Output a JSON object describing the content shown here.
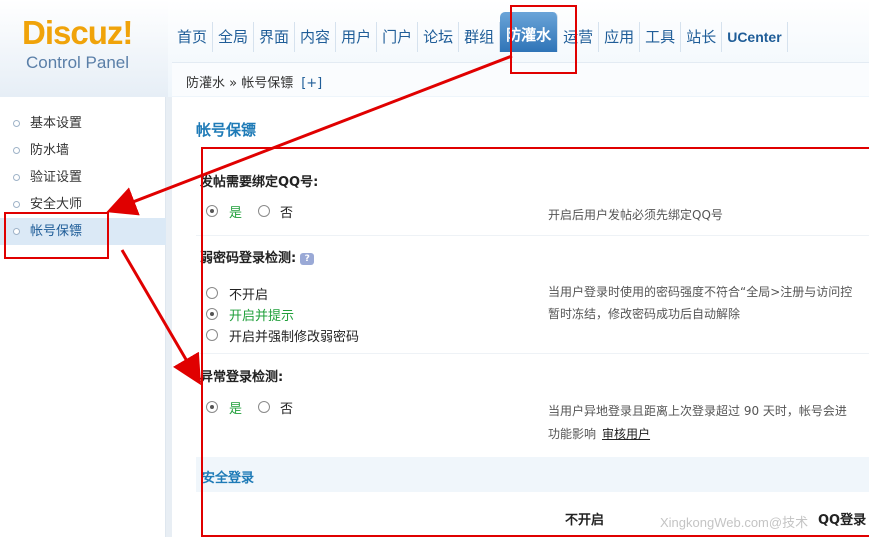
{
  "logo": {
    "main": "Discuz!",
    "sub": "Control Panel"
  },
  "topnav": [
    {
      "label": "首页"
    },
    {
      "label": "全局"
    },
    {
      "label": "界面"
    },
    {
      "label": "内容"
    },
    {
      "label": "用户"
    },
    {
      "label": "门户"
    },
    {
      "label": "论坛"
    },
    {
      "label": "群组"
    },
    {
      "label": "防灌水",
      "active": true
    },
    {
      "label": "运营"
    },
    {
      "label": "应用"
    },
    {
      "label": "工具"
    },
    {
      "label": "站长"
    },
    {
      "label": "UCenter"
    }
  ],
  "breadcrumb": {
    "text": "防灌水 » 帐号保镖",
    "plus": "[+]"
  },
  "sidebar": [
    {
      "label": "基本设置"
    },
    {
      "label": "防水墙"
    },
    {
      "label": "验证设置"
    },
    {
      "label": "安全大师"
    },
    {
      "label": "帐号保镖",
      "active": true
    }
  ],
  "page_title": "帐号保镖",
  "settings": {
    "qq_bind": {
      "label": "发帖需要绑定QQ号:",
      "options": [
        "是",
        "否"
      ],
      "selected": "是",
      "desc": "开启后用户发帖必须先绑定QQ号"
    },
    "weak_pwd": {
      "label": "弱密码登录检测:",
      "help_icon": "help-icon",
      "options": [
        "不开启",
        "开启并提示",
        "开启并强制修改弱密码"
      ],
      "selected": "开启并提示",
      "desc_1": "当用户登录时使用的密码强度不符合“全局>注册与访问控",
      "desc_2": "暂时冻结，修改密码成功后自动解除"
    },
    "abnormal_login": {
      "label": "异常登录检测:",
      "options": [
        "是",
        "否"
      ],
      "selected": "是",
      "desc_1": "当用户异地登录且距离上次登录超过 90 天时，帐号会进",
      "desc_2": "功能影响",
      "link": "审核用户"
    }
  },
  "section": {
    "title": "安全登录"
  },
  "table_headers": [
    "不开启",
    "QQ登录"
  ],
  "watermark": "XingkongWeb.com@技术"
}
